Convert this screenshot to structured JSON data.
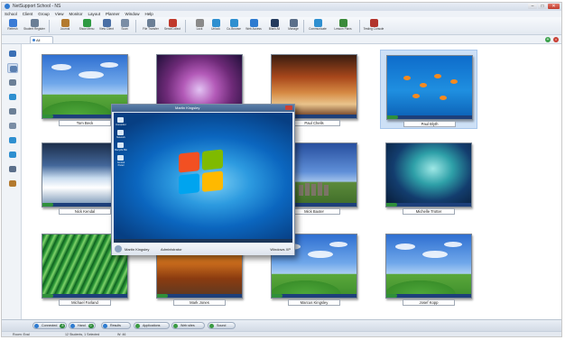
{
  "window": {
    "title": "NetSupport School - NS",
    "buttons": {
      "minimize": "–",
      "maximize": "□",
      "close": "✕"
    }
  },
  "menu": [
    "School",
    "Client",
    "Group",
    "View",
    "Monitor",
    "Layout",
    "Planner",
    "Window",
    "Help"
  ],
  "toolbar": [
    {
      "label": "Refresh",
      "icon": "refresh-icon",
      "color": "#3a7bd5"
    },
    {
      "label": "Student Register",
      "icon": "register-icon",
      "color": "#6b7f96"
    },
    {
      "label": "Journal",
      "icon": "journal-icon",
      "color": "#b37a2e"
    },
    {
      "label": "Show Menu",
      "icon": "show-menu-icon",
      "color": "#2e9a42"
    },
    {
      "label": "View Client",
      "icon": "view-client-icon",
      "color": "#4a6fa5"
    },
    {
      "label": "Scan",
      "icon": "scan-icon",
      "color": "#7a8da5"
    },
    {
      "label": "File Transfer",
      "icon": "file-transfer-icon",
      "color": "#6b7f96"
    },
    {
      "label": "Send/Collect",
      "icon": "send-collect-icon",
      "color": "#c0392b"
    },
    {
      "label": "Lock",
      "icon": "lock-icon",
      "color": "#8a8a8a"
    },
    {
      "label": "Unlock",
      "icon": "unlock-icon",
      "color": "#2e8fd0"
    },
    {
      "label": "Co-Browse",
      "icon": "co-browse-icon",
      "color": "#2e8fd0"
    },
    {
      "label": "Web Access",
      "icon": "web-access-icon",
      "color": "#2e7bd0"
    },
    {
      "label": "Blank All",
      "icon": "blank-all-icon",
      "color": "#243b5e"
    },
    {
      "label": "Manage",
      "icon": "manage-icon",
      "color": "#5b6f8a"
    },
    {
      "label": "Communicate",
      "icon": "communicate-icon",
      "color": "#2e8fd0"
    },
    {
      "label": "Lesson Plans",
      "icon": "lesson-plans-icon",
      "color": "#3a8a3a"
    },
    {
      "label": "Testing Console",
      "icon": "testing-console-icon",
      "color": "#b2342c"
    }
  ],
  "tabs": [
    {
      "label": "All"
    }
  ],
  "sidebar_icons": [
    {
      "icon": "group-icon",
      "color": "#3a6fb5"
    },
    {
      "icon": "thumbnail-view-icon",
      "color": "#5b7fb0",
      "active": true
    },
    {
      "icon": "user-icon",
      "color": "#6b7f96"
    },
    {
      "icon": "globe-icon",
      "color": "#2e8fd0"
    },
    {
      "icon": "document-icon",
      "color": "#6b7f96"
    },
    {
      "icon": "clipboard-icon",
      "color": "#7a8da5"
    },
    {
      "icon": "chat-icon",
      "color": "#2e8fd0"
    },
    {
      "icon": "network-icon",
      "color": "#2e8fd0"
    },
    {
      "icon": "printer-icon",
      "color": "#5b6f8a"
    },
    {
      "icon": "clock-icon",
      "color": "#b37a2e"
    }
  ],
  "students": [
    {
      "name": "Tom Beck",
      "wallpaper": "xp"
    },
    {
      "name": "",
      "wallpaper": "flower"
    },
    {
      "name": "Paul Chells",
      "wallpaper": "arch"
    },
    {
      "name": "Paul Blyth",
      "wallpaper": "fish",
      "selected": true
    },
    {
      "name": "Nick Kendal",
      "wallpaper": "ice"
    },
    {
      "name": "",
      "wallpaper": "hidden"
    },
    {
      "name": "Mick Baxter",
      "wallpaper": "stone"
    },
    {
      "name": "Michelle Trotter",
      "wallpaper": "aurora"
    },
    {
      "name": "Michael Farland",
      "wallpaper": "fern"
    },
    {
      "name": "Mark Jones",
      "wallpaper": "autumn"
    },
    {
      "name": "Marcus Kingsley",
      "wallpaper": "xp"
    },
    {
      "name": "Josef Kopp",
      "wallpaper": "xp"
    }
  ],
  "viewer": {
    "title": "Martin Kingsley",
    "user": "Martin Kingsley",
    "role": "Administrator",
    "os": "Windows XP",
    "desktop_icons": [
      "Computer",
      "Network",
      "Recycle Bin",
      "Control Panel"
    ]
  },
  "bottombar": [
    {
      "label": "Connected",
      "count": "8",
      "icon": "connected-icon",
      "color": "#2e7bd0"
    },
    {
      "label": "Hand",
      "count": "0",
      "icon": "hand-icon",
      "color": "#2e7bd0"
    },
    {
      "label": "Results",
      "count": "",
      "icon": "results-icon",
      "color": "#2e7bd0"
    },
    {
      "label": "Applications",
      "count": "",
      "icon": "applications-icon",
      "color": "#3a9a42"
    },
    {
      "label": "Web sites",
      "count": "",
      "icon": "websites-icon",
      "color": "#3a9a42"
    },
    {
      "label": "Sound",
      "count": "",
      "icon": "sound-icon",
      "color": "#3a9a42"
    }
  ],
  "status": {
    "left": "Room: Eval",
    "middle": "12 Students, 1 Selected",
    "right": "W: 46"
  }
}
